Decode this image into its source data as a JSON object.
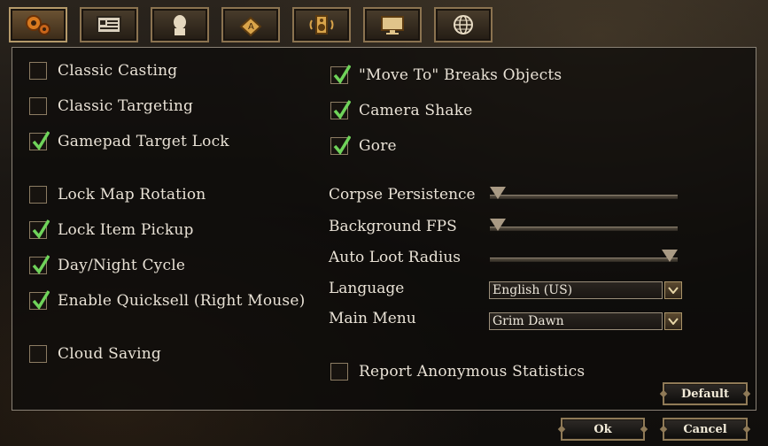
{
  "tabs": [
    {
      "name": "gears-icon",
      "active": true
    },
    {
      "name": "interface-icon",
      "active": false
    },
    {
      "name": "character-icon",
      "active": false
    },
    {
      "name": "keyboard-icon",
      "active": false
    },
    {
      "name": "speaker-icon",
      "active": false
    },
    {
      "name": "monitor-icon",
      "active": false
    },
    {
      "name": "globe-icon",
      "active": false
    }
  ],
  "left_options": [
    {
      "label": "Classic Casting",
      "checked": false
    },
    {
      "label": "Classic Targeting",
      "checked": false
    },
    {
      "label": "Gamepad Target Lock",
      "checked": true
    },
    {
      "label": "Lock Map Rotation",
      "checked": false
    },
    {
      "label": "Lock Item Pickup",
      "checked": true
    },
    {
      "label": "Day/Night Cycle",
      "checked": true
    },
    {
      "label": "Enable Quicksell (Right Mouse)",
      "checked": true
    },
    {
      "label": "Cloud Saving",
      "checked": false
    }
  ],
  "right_options": [
    {
      "label": "\"Move To\" Breaks Objects",
      "checked": true
    },
    {
      "label": "Camera Shake",
      "checked": true
    },
    {
      "label": "Gore",
      "checked": true
    }
  ],
  "sliders": [
    {
      "label": "Corpse Persistence",
      "value": 0.0
    },
    {
      "label": "Background FPS",
      "value": 0.0
    },
    {
      "label": "Auto Loot Radius",
      "value": 1.0
    }
  ],
  "selects": [
    {
      "label": "Language",
      "value": "English (US)"
    },
    {
      "label": "Main Menu",
      "value": "Grim Dawn"
    }
  ],
  "stats_option": {
    "label": "Report Anonymous Statistics",
    "checked": false
  },
  "buttons": {
    "default": "Default",
    "ok": "Ok",
    "cancel": "Cancel"
  },
  "colors": {
    "check": "#6fd35a",
    "accent": "#8f7a57"
  }
}
